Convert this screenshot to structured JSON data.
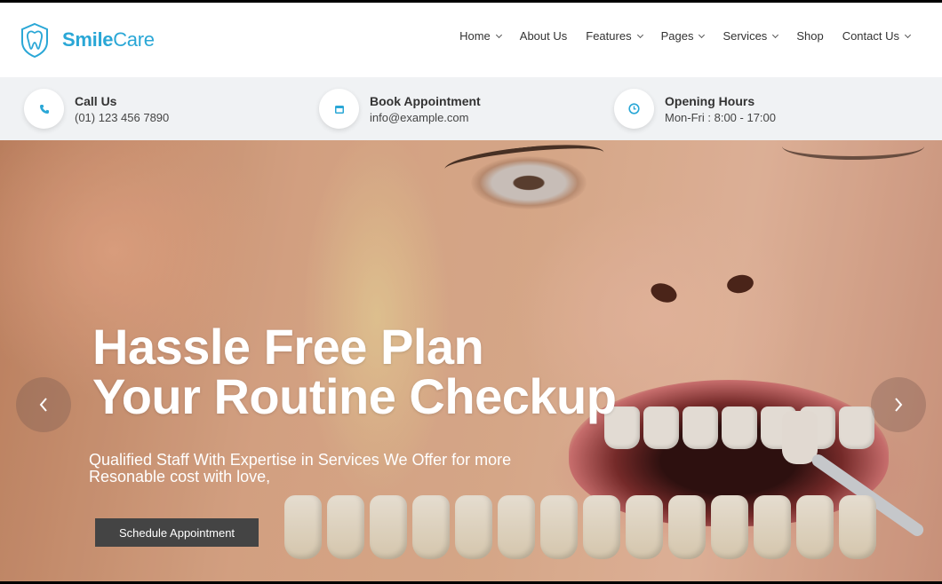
{
  "brand": {
    "name_bold": "Smile",
    "name_light": "Care",
    "color": "#2aa7d6"
  },
  "nav": {
    "items": [
      {
        "label": "Home",
        "dropdown": true
      },
      {
        "label": "About Us",
        "dropdown": false
      },
      {
        "label": "Features",
        "dropdown": true
      },
      {
        "label": "Pages",
        "dropdown": true
      },
      {
        "label": "Services",
        "dropdown": true
      },
      {
        "label": "Shop",
        "dropdown": false
      },
      {
        "label": "Contact Us",
        "dropdown": true
      }
    ]
  },
  "info": {
    "call": {
      "title": "Call Us",
      "value": "(01) 123 456 7890",
      "icon": "phone-icon"
    },
    "appointment": {
      "title": "Book Appointment",
      "value": "info@example.com",
      "icon": "calendar-icon"
    },
    "hours": {
      "title": "Opening Hours",
      "value": "Mon-Fri : 8:00 - 17:00",
      "icon": "clock-icon"
    }
  },
  "hero": {
    "title_line1": "Hassle Free Plan",
    "title_line2": "Your Routine Checkup",
    "subtitle_line1": "Qualified Staff With Expertise in Services We Offer for more",
    "subtitle_line2": "Resonable cost with love,",
    "cta_label": "Schedule Appointment",
    "prev_icon": "chevron-left-icon",
    "next_icon": "chevron-right-icon"
  },
  "colors": {
    "accent": "#2aa7d6",
    "cta_bg": "#444444",
    "infobar_bg": "#f0f2f4"
  }
}
